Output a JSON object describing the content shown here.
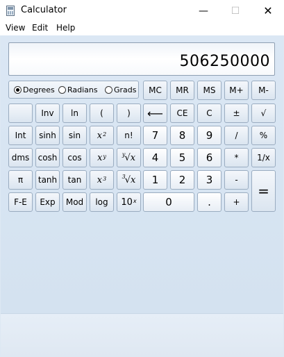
{
  "window": {
    "title": "Calculator",
    "minimize": "—",
    "maximize": "☐",
    "close": "✕"
  },
  "menu": [
    "View",
    "Edit",
    "Help"
  ],
  "display": {
    "value": "506250000"
  },
  "angle_mode": {
    "options": [
      "Degrees",
      "Radians",
      "Grads"
    ],
    "selected": "Degrees"
  },
  "buttons": {
    "mc": "MC",
    "mr": "MR",
    "ms": "MS",
    "mplus": "M+",
    "mminus": "M-",
    "inv": "Inv",
    "ln": "ln",
    "open_paren": "(",
    "close_paren": ")",
    "backspace": "⟵",
    "ce": "CE",
    "c": "C",
    "plusminus": "±",
    "sqrt": "√",
    "int": "Int",
    "sinh": "sinh",
    "sin": "sin",
    "x": "x",
    "sq_exp": "2",
    "factorial": "n!",
    "d7": "7",
    "d8": "8",
    "d9": "9",
    "divide": "/",
    "percent": "%",
    "dms": "dms",
    "cosh": "cosh",
    "cos": "cos",
    "y": "y",
    "root_y": "y",
    "root_x": "x",
    "d4": "4",
    "d5": "5",
    "d6": "6",
    "multiply": "*",
    "reciprocal": "1/x",
    "pi": "π",
    "tanh": "tanh",
    "tan": "tan",
    "cube_exp": "3",
    "cbrt_idx": "3",
    "cbrt_x": "x",
    "d1": "1",
    "d2": "2",
    "d3": "3",
    "minus": "-",
    "equals": "=",
    "fe": "F-E",
    "exp": "Exp",
    "mod": "Mod",
    "log": "log",
    "ten": "10",
    "ten_exp": "x",
    "d0": "0",
    "dot": ".",
    "plus": "+"
  }
}
